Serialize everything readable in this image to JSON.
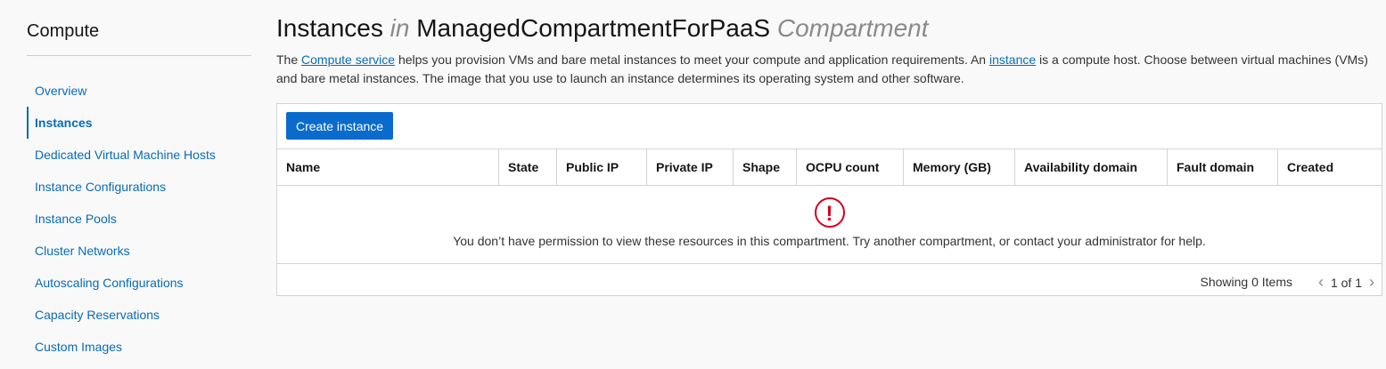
{
  "sidebar": {
    "title": "Compute",
    "items": [
      {
        "label": "Overview"
      },
      {
        "label": "Instances"
      },
      {
        "label": "Dedicated Virtual Machine Hosts"
      },
      {
        "label": "Instance Configurations"
      },
      {
        "label": "Instance Pools"
      },
      {
        "label": "Cluster Networks"
      },
      {
        "label": "Autoscaling Configurations"
      },
      {
        "label": "Capacity Reservations"
      },
      {
        "label": "Custom Images"
      }
    ]
  },
  "header": {
    "title_main": "Instances",
    "title_in": "in",
    "title_compartment": "ManagedCompartmentForPaaS",
    "title_suffix": "Compartment"
  },
  "description": {
    "part1": "The",
    "link1": "Compute service",
    "part2": "helps you provision VMs and bare metal instances to meet your compute and application requirements. An",
    "link2": "instance",
    "part3": "is a compute host. Choose between virtual machines (VMs) and bare metal instances. The image that you use to launch an instance determines its operating system and other software."
  },
  "toolbar": {
    "create_label": "Create instance"
  },
  "table": {
    "columns": [
      "Name",
      "State",
      "Public IP",
      "Private IP",
      "Shape",
      "OCPU count",
      "Memory (GB)",
      "Availability domain",
      "Fault domain",
      "Created"
    ],
    "empty_icon": "!",
    "empty_message": "You don’t have permission to view these resources in this compartment. Try another compartment, or contact your administrator for help."
  },
  "footer": {
    "showing": "Showing 0 Items",
    "page": "1 of 1",
    "prev_icon": "‹",
    "next_icon": "›"
  }
}
